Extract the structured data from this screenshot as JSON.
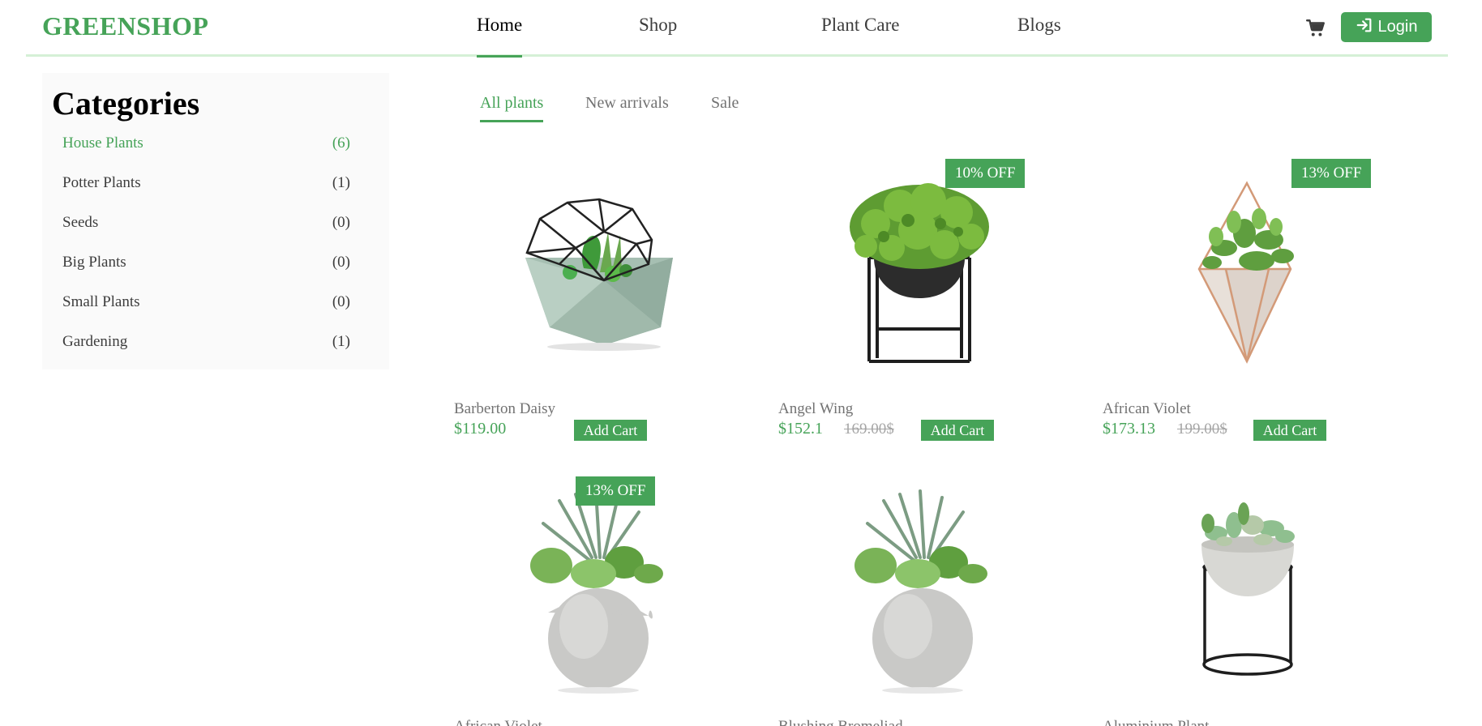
{
  "header": {
    "logo": "GREENSHOP",
    "nav": [
      {
        "label": "Home",
        "active": true
      },
      {
        "label": "Shop",
        "active": false
      },
      {
        "label": "Plant Care",
        "active": false
      },
      {
        "label": "Blogs",
        "active": false
      }
    ],
    "cart_icon": "shopping-cart-icon",
    "login_label": "Login",
    "login_icon": "login-arrow-icon"
  },
  "sidebar": {
    "title": "Categories",
    "categories": [
      {
        "label": "House Plants",
        "count": "(6)",
        "active": true
      },
      {
        "label": "Potter Plants",
        "count": "(1)",
        "active": false
      },
      {
        "label": "Seeds",
        "count": "(0)",
        "active": false
      },
      {
        "label": "Big Plants",
        "count": "(0)",
        "active": false
      },
      {
        "label": "Small Plants",
        "count": "(0)",
        "active": false
      },
      {
        "label": "Gardening",
        "count": "(1)",
        "active": false
      }
    ]
  },
  "tabs": [
    {
      "label": "All plants",
      "active": true
    },
    {
      "label": "New arrivals",
      "active": false
    },
    {
      "label": "Sale",
      "active": false
    }
  ],
  "products": [
    {
      "name": "Barberton Daisy",
      "price": "$119.00",
      "old_price": "",
      "badge": "",
      "add_label": "Add Cart",
      "image": "geometric-terrarium-plant"
    },
    {
      "name": "Angel Wing",
      "price": "$152.1",
      "old_price": "169.00$",
      "badge": "10% OFF",
      "add_label": "Add Cart",
      "image": "bowl-plant-on-black-stand"
    },
    {
      "name": "African Violet",
      "price": "$173.13",
      "old_price": "199.00$",
      "badge": "13% OFF",
      "add_label": "Add Cart",
      "image": "hanging-copper-planter"
    },
    {
      "name": "African Violet",
      "price": "",
      "old_price": "",
      "badge": "13% OFF",
      "add_label": "",
      "image": "succulents-in-concrete-sphere"
    },
    {
      "name": "Blushing Bromeliad",
      "price": "",
      "old_price": "",
      "badge": "",
      "add_label": "",
      "image": "succulents-in-concrete-sphere"
    },
    {
      "name": "Aluminium Plant",
      "price": "",
      "old_price": "",
      "badge": "",
      "add_label": "",
      "image": "succulent-bowl-on-wire-stand"
    }
  ],
  "colors": {
    "accent": "#46a358",
    "text": "#3d3d3d",
    "muted": "#727272",
    "header_border": "#d5f0d6"
  }
}
